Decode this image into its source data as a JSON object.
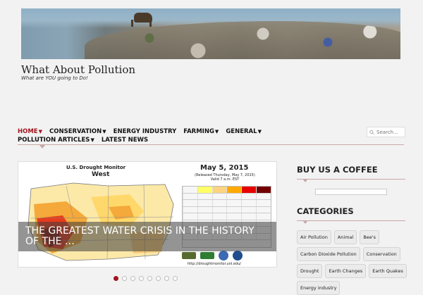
{
  "site": {
    "title": "What About Pollution",
    "description": "What are YOU going to Do!"
  },
  "nav": {
    "row1": [
      {
        "label": "HOME",
        "has_dropdown": true,
        "active": true
      },
      {
        "label": "CONSERVATION",
        "has_dropdown": true
      },
      {
        "label": "ENERGY INDUSTRY",
        "has_dropdown": false
      },
      {
        "label": "FARMING",
        "has_dropdown": true
      },
      {
        "label": "GENERAL",
        "has_dropdown": true
      }
    ],
    "row2": [
      {
        "label": "POLLUTION ARTICLES",
        "has_dropdown": true
      },
      {
        "label": "LATEST NEWS",
        "has_dropdown": false
      }
    ],
    "dropdown_icon": "caret-down-icon"
  },
  "search": {
    "placeholder": "Search...",
    "icon": "search-icon"
  },
  "slider": {
    "image": {
      "title": "U.S. Drought Monitor",
      "region": "West",
      "date": "May 5, 2015",
      "sub1": "(Released Thursday, May 7, 2015)",
      "sub2": "Valid 7 a.m. EST",
      "url": "http://droughtmonitor.unl.edu/"
    },
    "caption": "THE GREATEST WATER CRISIS IN THE HISTORY OF THE …",
    "dot_count": 8,
    "active_dot": 0
  },
  "sidebar": {
    "coffee_title": "BUY US A COFFEE",
    "categories_title": "CATEGORIES",
    "categories": [
      "Air Pollution",
      "Animal",
      "Bee's",
      "Carbon Dioxide Pollution",
      "Conservation",
      "Drought",
      "Earth Changes",
      "Earth Quakes",
      "Energy industry"
    ]
  },
  "colors": {
    "accent": "#a0141e",
    "background": "#f2f2f2"
  }
}
